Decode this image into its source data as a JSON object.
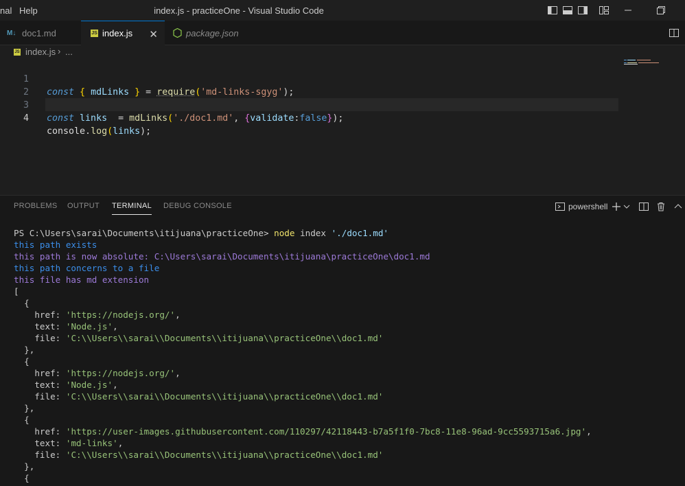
{
  "titlebar": {
    "menu_terminal": "nal",
    "menu_help": "Help",
    "title": "index.js - practiceOne - Visual Studio Code"
  },
  "tabs": [
    {
      "label": "doc1.md",
      "icon": "markdown-icon",
      "active": false
    },
    {
      "label": "index.js",
      "icon": "js-icon",
      "active": true
    },
    {
      "label": "package.json",
      "icon": "nodejs-icon",
      "active": false
    }
  ],
  "breadcrumb": {
    "file": "index.js",
    "tail": "..."
  },
  "editor": {
    "line_numbers": [
      "1",
      "2",
      "3",
      "4"
    ],
    "l1": {
      "kw": "const",
      "open": "{",
      "name": "mdLinks",
      "close": "}",
      "eq": "=",
      "fn": "require",
      "p1": "(",
      "str": "'md-links-sgyg'",
      "p2": ");"
    },
    "l3": {
      "kw": "const",
      "name": "links",
      "eq": " =",
      "fn": "mdLinks",
      "p1": "(",
      "str": "'./doc1.md'",
      "comma": ",",
      "ob": "{",
      "key": "validate",
      "colon": ":",
      "val": "false",
      "cb": "}",
      "p2": ");"
    },
    "l4": {
      "obj": "console",
      "dot": ".",
      "fn": "log",
      "p1": "(",
      "arg": "links",
      "p2": ");"
    }
  },
  "panel": {
    "tabs": [
      "PROBLEMS",
      "OUTPUT",
      "TERMINAL",
      "DEBUG CONSOLE"
    ],
    "active_tab": "TERMINAL",
    "shell_label": "powershell"
  },
  "terminal": {
    "prompt": "PS C:\\Users\\sarai\\Documents\\itijuana\\practiceOne>",
    "cmd": "node",
    "cmd_arg1": "index",
    "cmd_arg2": "'./doc1.md'",
    "info1": "this path exists",
    "info2": "this path is now absolute: C:\\Users\\sarai\\Documents\\itijuana\\practiceOne\\doc1.md",
    "info3": "this path concerns to a file",
    "info4": "this file has md extension",
    "open_bracket": "[",
    "open_brace": "{",
    "close_brace": "},",
    "key_href": "href:",
    "key_text": "text:",
    "key_file": "file:",
    "items": [
      {
        "href": "'https://nodejs.org/'",
        "text": "'Node.js'",
        "file": "'C:\\\\Users\\\\sarai\\\\Documents\\\\itijuana\\\\practiceOne\\\\doc1.md'"
      },
      {
        "href": "'https://nodejs.org/'",
        "text": "'Node.js'",
        "file": "'C:\\\\Users\\\\sarai\\\\Documents\\\\itijuana\\\\practiceOne\\\\doc1.md'"
      },
      {
        "href": "'https://user-images.githubusercontent.com/110297/42118443-b7a5f1f0-7bc8-11e8-96ad-9cc5593715a6.jpg'",
        "text": "'md-links'",
        "file": "'C:\\\\Users\\\\sarai\\\\Documents\\\\itijuana\\\\practiceOne\\\\doc1.md'"
      }
    ]
  },
  "colors": {
    "accent": "#0078d4",
    "background": "#1e1e1e",
    "panel": "#181818"
  }
}
